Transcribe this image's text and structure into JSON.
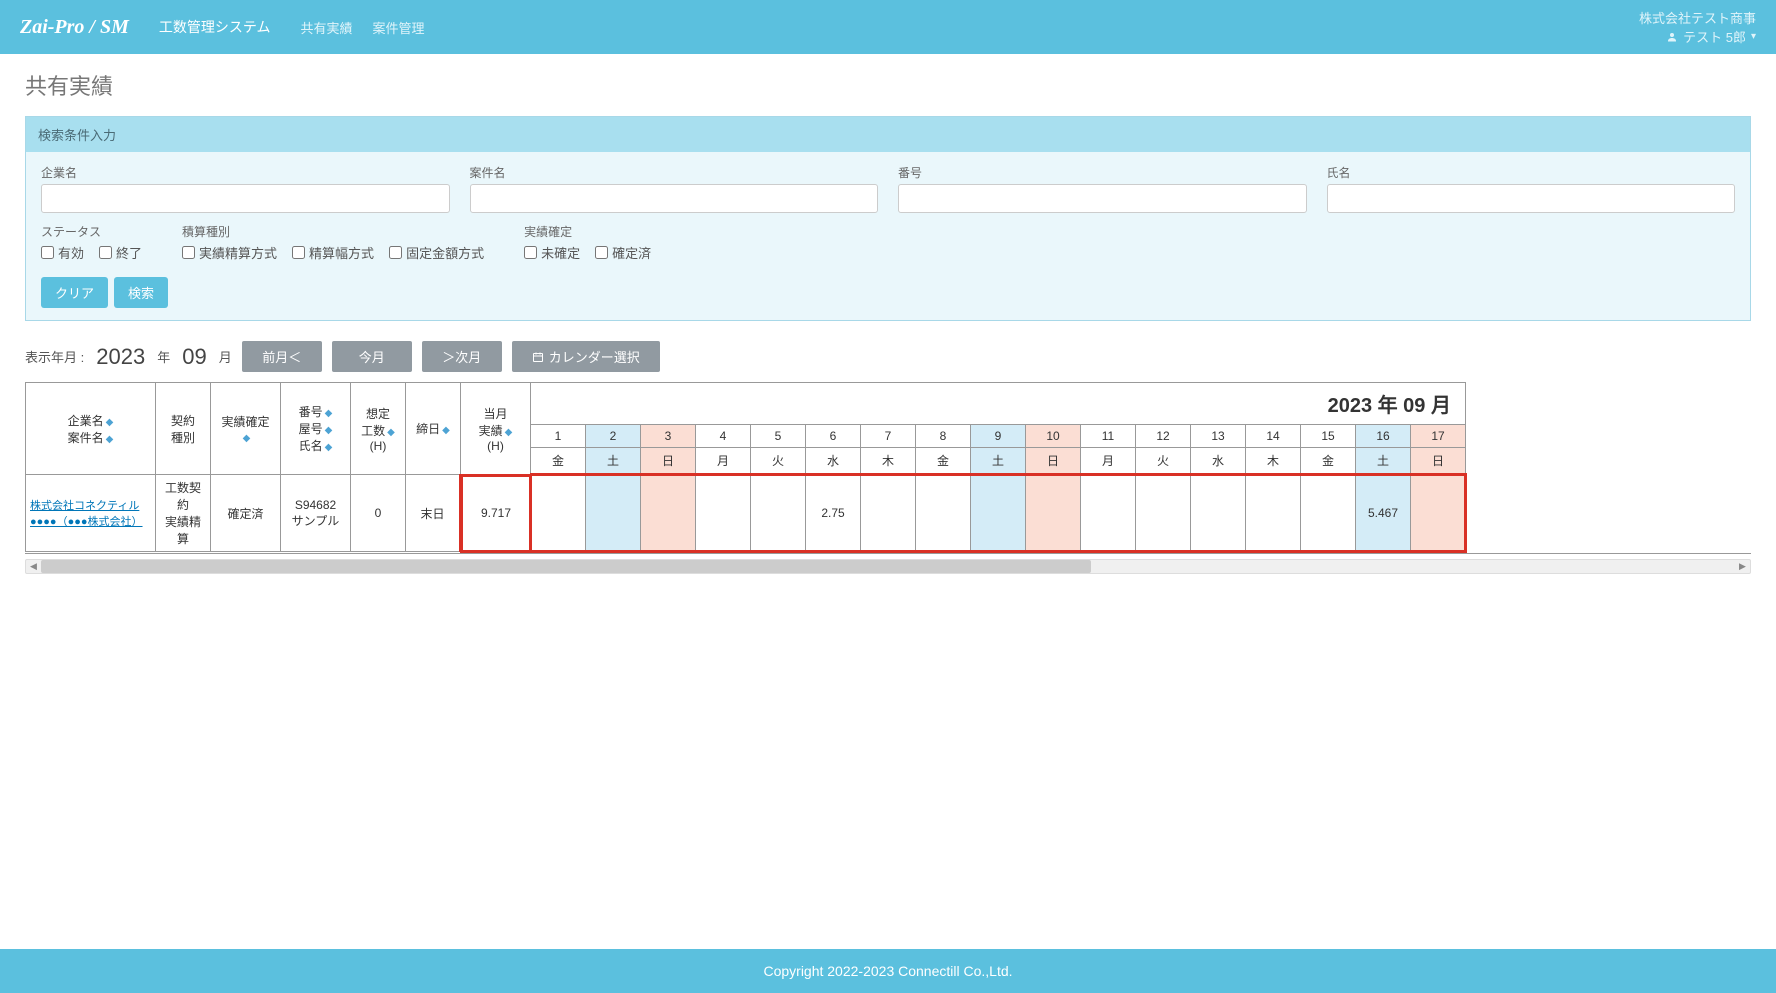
{
  "header": {
    "logo": "Zai-Pro / SM",
    "system_name": "工数管理システム",
    "nav": {
      "shared": "共有実績",
      "cases": "案件管理"
    },
    "company": "株式会社テスト商事",
    "user": "テスト 5郎"
  },
  "page": {
    "title": "共有実績"
  },
  "search": {
    "panel_title": "検索条件入力",
    "labels": {
      "company": "企業名",
      "case": "案件名",
      "number": "番号",
      "name": "氏名",
      "status": "ステータス",
      "calc_type": "積算種別",
      "confirm": "実績確定"
    },
    "checkboxes": {
      "valid": "有効",
      "ended": "終了",
      "actual": "実績精算方式",
      "range": "精算幅方式",
      "fixed": "固定金額方式",
      "unconfirmed": "未確定",
      "confirmed": "確定済"
    },
    "buttons": {
      "clear": "クリア",
      "search": "検索"
    }
  },
  "display": {
    "label": "表示年月 :",
    "year": "2023",
    "year_unit": "年",
    "month": "09",
    "month_unit": "月",
    "prev": "前月＜",
    "today": "今月",
    "next": "＞次月",
    "calendar": "カレンダー選択"
  },
  "table": {
    "headers": {
      "company_case": {
        "l1": "企業名",
        "l2": "案件名"
      },
      "contract": {
        "l1": "契約",
        "l2": "種別"
      },
      "confirm": "実績確定",
      "num_name": {
        "l1": "番号",
        "l2": "屋号",
        "l3": "氏名"
      },
      "est": {
        "l1": "想定",
        "l2": "工数",
        "l3": "(H)"
      },
      "deadline": "締日",
      "month_result": {
        "l1": "当月",
        "l2": "実績",
        "l3": "(H)"
      },
      "month_title": "2023 年 09 月"
    },
    "days": [
      {
        "num": "1",
        "dow": "金",
        "cls": ""
      },
      {
        "num": "2",
        "dow": "土",
        "cls": "day-sat"
      },
      {
        "num": "3",
        "dow": "日",
        "cls": "day-sun"
      },
      {
        "num": "4",
        "dow": "月",
        "cls": ""
      },
      {
        "num": "5",
        "dow": "火",
        "cls": ""
      },
      {
        "num": "6",
        "dow": "水",
        "cls": ""
      },
      {
        "num": "7",
        "dow": "木",
        "cls": ""
      },
      {
        "num": "8",
        "dow": "金",
        "cls": ""
      },
      {
        "num": "9",
        "dow": "土",
        "cls": "day-sat"
      },
      {
        "num": "10",
        "dow": "日",
        "cls": "day-sun"
      },
      {
        "num": "11",
        "dow": "月",
        "cls": ""
      },
      {
        "num": "12",
        "dow": "火",
        "cls": ""
      },
      {
        "num": "13",
        "dow": "水",
        "cls": ""
      },
      {
        "num": "14",
        "dow": "木",
        "cls": ""
      },
      {
        "num": "15",
        "dow": "金",
        "cls": ""
      },
      {
        "num": "16",
        "dow": "土",
        "cls": "day-sat"
      },
      {
        "num": "17",
        "dow": "日",
        "cls": "day-sun"
      }
    ],
    "rows": [
      {
        "company": "株式会社コネクティル",
        "case": "●●●●（●●●株式会社）",
        "contract_l1": "工数契約",
        "contract_l2": "実績精算",
        "confirm": "確定済",
        "number": "S94682",
        "name": "サンプル",
        "est": "0",
        "deadline": "末日",
        "month_result": "9.717",
        "values": [
          "",
          "",
          "",
          "",
          "",
          "2.75",
          "",
          "",
          "",
          "",
          "",
          "",
          "",
          "",
          "",
          "5.467",
          ""
        ]
      }
    ]
  },
  "footer": {
    "copyright": "Copyright 2022-2023 Connectill Co.,Ltd."
  }
}
